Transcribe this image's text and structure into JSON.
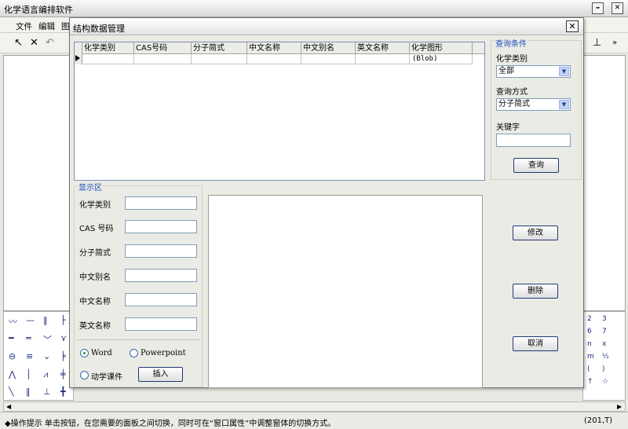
{
  "app": {
    "title": "化学语言编排软件",
    "minimize": "–",
    "maximize": "✕"
  },
  "menu": [
    "文件",
    "编辑",
    "图"
  ],
  "toolbar": {
    "pointer": "↖",
    "cross": "✕",
    "undo": "↶",
    "more": "»"
  },
  "dialog": {
    "title": "结构数据管理",
    "close": "✕",
    "grid": {
      "columns": [
        "化学类别",
        "CAS号码",
        "分子简式",
        "中文名称",
        "中文别名",
        "英文名称",
        "化学图形"
      ],
      "rows": [
        [
          "",
          "",
          "",
          "",
          "",
          "",
          "(Blob)"
        ]
      ]
    },
    "query": {
      "group_label": "查询条件",
      "category_label": "化学类别",
      "category_value": "全部",
      "method_label": "查询方式",
      "method_value": "分子简式",
      "keyword_label": "关键字",
      "keyword_value": "",
      "query_button": "查询"
    },
    "display": {
      "group_label": "显示区",
      "fields": [
        {
          "label": "化学类别",
          "value": ""
        },
        {
          "label": "CAS 号码",
          "value": ""
        },
        {
          "label": "分子简式",
          "value": ""
        },
        {
          "label": "中文别名",
          "value": ""
        },
        {
          "label": "中文名称",
          "value": ""
        },
        {
          "label": "英文名称",
          "value": ""
        }
      ],
      "radio_word": "Word",
      "radio_ppt": "Powerpoint",
      "radio_courseware": "动学课件",
      "insert_button": "插入",
      "selected_radio": "Word"
    },
    "actions": {
      "edit": "修改",
      "delete": "删除",
      "cancel": "取消"
    }
  },
  "status": {
    "text": "◆操作提示  单击按钮，在您需要的面板之间切换，同时可在“窗口属性”中调整窗体的切换方式。",
    "coords": "(201,T)"
  }
}
